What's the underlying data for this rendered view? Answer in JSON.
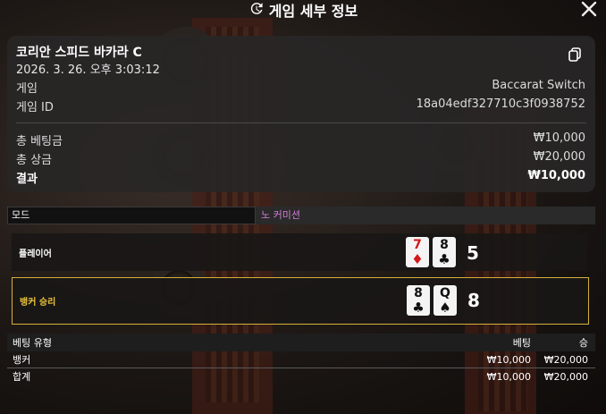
{
  "header": {
    "title": "게임 세부 정보"
  },
  "info": {
    "game_name": "코리안 스피드 바카라 C",
    "datetime": "2026. 3. 26. 오후 3:03:12",
    "game_label": "게임",
    "game_value": "Baccarat Switch",
    "id_label": "게임 ID",
    "id_value": "18a04edf327710c3f0938752",
    "total_bet_label": "총 베팅금",
    "total_bet_value": "₩10,000",
    "total_win_label": "총 상금",
    "total_win_value": "₩20,000",
    "result_label": "결과",
    "result_value": "₩10,000"
  },
  "mode": {
    "label": "모드",
    "value": "노 커미션",
    "value_color": "#d47fd8"
  },
  "hands": {
    "player": {
      "label": "플레이어",
      "score": "5",
      "cards": [
        {
          "rank": "7",
          "suit": "♦",
          "color": "red"
        },
        {
          "rank": "8",
          "suit": "♣",
          "color": "black"
        }
      ]
    },
    "banker": {
      "label": "뱅커 승리",
      "score": "8",
      "cards": [
        {
          "rank": "8",
          "suit": "♣",
          "color": "black"
        },
        {
          "rank": "Q",
          "suit": "♠",
          "color": "black"
        }
      ]
    }
  },
  "bets": {
    "headers": {
      "type": "베팅 유형",
      "bet": "베팅",
      "win": "승"
    },
    "rows": [
      {
        "type": "뱅커",
        "bet": "₩10,000",
        "win": "₩20,000"
      }
    ],
    "total": {
      "type": "합계",
      "bet": "₩10,000",
      "win": "₩20,000"
    }
  },
  "colors": {
    "winner_accent": "#d6b13c",
    "red_suit": "#d21818"
  }
}
